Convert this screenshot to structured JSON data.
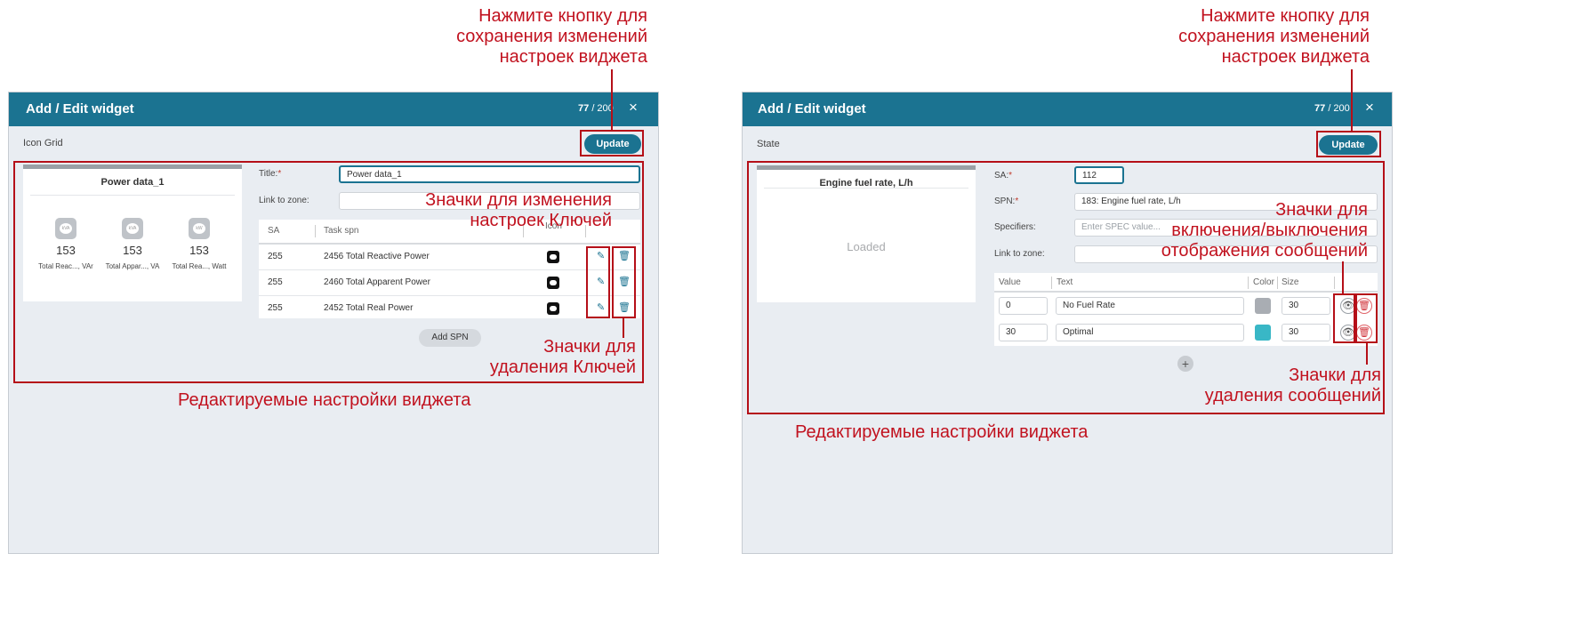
{
  "annotations": {
    "left_save": [
      "Нажмите кнопку для",
      "сохранения изменений",
      "настроек виджета"
    ],
    "left_edit_keys": [
      "Значки для изменения",
      "настроек Ключей"
    ],
    "left_delete_keys": [
      "Значки для",
      "удаления Ключей"
    ],
    "left_editable": "Редактируемые настройки виджета",
    "right_save": [
      "Нажмите кнопку для",
      "сохранения изменений",
      "настроек виджета"
    ],
    "right_toggle": [
      "Значки для",
      "включения/выключения",
      "отображения сообщений"
    ],
    "right_delete": [
      "Значки для",
      "удаления сообщений"
    ],
    "right_editable": "Редактируемые настройки виджета"
  },
  "left_panel": {
    "title": "Add / Edit widget",
    "counter_current": "77",
    "counter_total": "/ 200",
    "close": "×",
    "widget_type": "Icon Grid",
    "update_label": "Update",
    "preview": {
      "title": "Power data_1",
      "tiles": [
        {
          "icon": "kvar-icon",
          "value": "153",
          "caption": "Total Reac..., VAr"
        },
        {
          "icon": "kva-icon",
          "value": "153",
          "caption": "Total Appar..., VA"
        },
        {
          "icon": "kw-icon",
          "value": "153",
          "caption": "Total Rea..., Watt"
        }
      ]
    },
    "form": {
      "title_label": "Title:",
      "title_value": "Power data_1",
      "zone_label": "Link to zone:",
      "zone_value": ""
    },
    "table": {
      "headers": {
        "sa": "SA",
        "task_spn": "Task spn",
        "icon": "Icon"
      },
      "rows": [
        {
          "sa": "255",
          "spn": "2456 Total Reactive Power"
        },
        {
          "sa": "255",
          "spn": "2460 Total Apparent Power"
        },
        {
          "sa": "255",
          "spn": "2452 Total Real Power"
        }
      ]
    },
    "add_spn_label": "Add SPN"
  },
  "right_panel": {
    "title": "Add / Edit widget",
    "counter_current": "77",
    "counter_total": "/ 200",
    "close": "×",
    "widget_type": "State",
    "update_label": "Update",
    "preview": {
      "title": "Engine fuel rate, L/h",
      "status": "Loaded"
    },
    "form": {
      "sa_label": "SA:",
      "sa_value": "112",
      "spn_label": "SPN:",
      "spn_value": "183: Engine fuel rate, L/h",
      "spec_label": "Specifiers:",
      "spec_placeholder": "Enter SPEC value...",
      "zone_label": "Link to zone:"
    },
    "table": {
      "headers": {
        "value": "Value",
        "text": "Text",
        "color": "Color",
        "size": "Size"
      },
      "rows": [
        {
          "value": "0",
          "text": "No Fuel Rate",
          "color": "#a9adb3",
          "size": "30"
        },
        {
          "value": "30",
          "text": "Optimal",
          "color": "#39b7c6",
          "size": "30"
        }
      ]
    }
  }
}
